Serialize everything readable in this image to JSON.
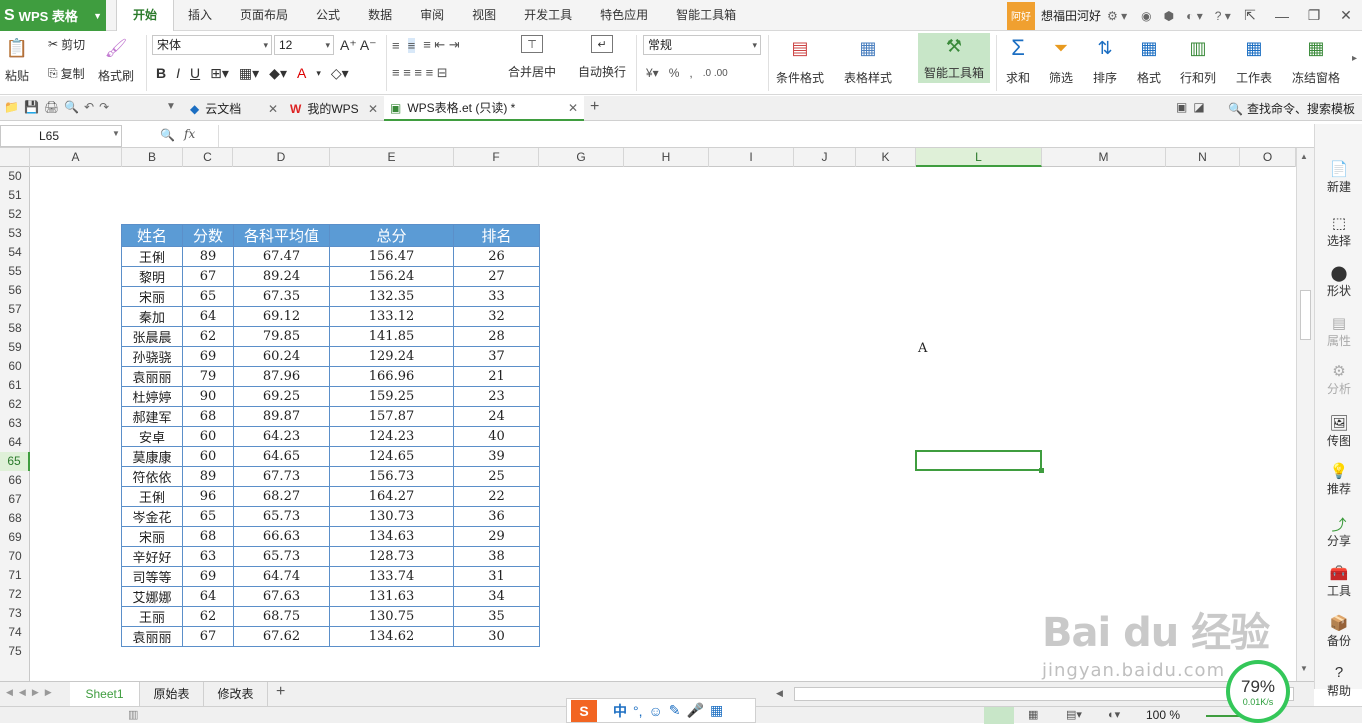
{
  "app": {
    "name": "WPS 表格"
  },
  "ribbon_tabs": [
    "开始",
    "插入",
    "页面布局",
    "公式",
    "数据",
    "审阅",
    "视图",
    "开发工具",
    "特色应用",
    "智能工具箱"
  ],
  "user": {
    "avatar_text": "阿好",
    "name": "想福田河好"
  },
  "toolbar": {
    "paste": "粘贴",
    "cut": "剪切",
    "copy": "复制",
    "format_painter": "格式刷",
    "font_name": "宋体",
    "font_size": "12",
    "number_format": "常规",
    "merge_center": "合并居中",
    "wrap_text": "自动换行",
    "cond_format": "条件格式",
    "table_style": "表格样式",
    "smart_toolbox": "智能工具箱",
    "sum": "求和",
    "filter": "筛选",
    "sort": "排序",
    "format": "格式",
    "row_col": "行和列",
    "worksheet": "工作表",
    "freeze": "冻结窗格"
  },
  "doc_tabs": [
    {
      "label": "云文档"
    },
    {
      "label": "我的WPS"
    },
    {
      "label": "WPS表格.et (只读) *"
    }
  ],
  "search": {
    "label": "查找命令、搜索模板"
  },
  "formula": {
    "namebox": "L65",
    "fx": "fx",
    "value": ""
  },
  "columns": [
    "A",
    "B",
    "C",
    "D",
    "E",
    "F",
    "G",
    "H",
    "I",
    "J",
    "K",
    "L",
    "M",
    "N",
    "O"
  ],
  "rows": [
    "50",
    "51",
    "52",
    "53",
    "54",
    "55",
    "56",
    "57",
    "58",
    "59",
    "60",
    "61",
    "62",
    "63",
    "64",
    "65",
    "66",
    "67",
    "68",
    "69",
    "70",
    "71",
    "72",
    "73",
    "74",
    "75"
  ],
  "table": {
    "headers": [
      "姓名",
      "分数",
      "各科平均值",
      "总分",
      "排名"
    ],
    "rows": [
      [
        "王俐",
        "89",
        "67.47",
        "156.47",
        "26"
      ],
      [
        "黎明",
        "67",
        "89.24",
        "156.24",
        "27"
      ],
      [
        "宋丽",
        "65",
        "67.35",
        "132.35",
        "33"
      ],
      [
        "秦加",
        "64",
        "69.12",
        "133.12",
        "32"
      ],
      [
        "张晨晨",
        "62",
        "79.85",
        "141.85",
        "28"
      ],
      [
        "孙骁骁",
        "69",
        "60.24",
        "129.24",
        "37"
      ],
      [
        "袁丽丽",
        "79",
        "87.96",
        "166.96",
        "21"
      ],
      [
        "杜婷婷",
        "90",
        "69.25",
        "159.25",
        "23"
      ],
      [
        "郝建军",
        "68",
        "89.87",
        "157.87",
        "24"
      ],
      [
        "安卓",
        "60",
        "64.23",
        "124.23",
        "40"
      ],
      [
        "莫康康",
        "60",
        "64.65",
        "124.65",
        "39"
      ],
      [
        "符依依",
        "89",
        "67.73",
        "156.73",
        "25"
      ],
      [
        "王俐",
        "96",
        "68.27",
        "164.27",
        "22"
      ],
      [
        "岑金花",
        "65",
        "65.73",
        "130.73",
        "36"
      ],
      [
        "宋丽",
        "68",
        "66.63",
        "134.63",
        "29"
      ],
      [
        "辛好好",
        "63",
        "65.73",
        "128.73",
        "38"
      ],
      [
        "司等等",
        "69",
        "64.74",
        "133.74",
        "31"
      ],
      [
        "艾娜娜",
        "64",
        "67.63",
        "131.63",
        "34"
      ],
      [
        "王丽",
        "62",
        "68.75",
        "130.75",
        "35"
      ],
      [
        "袁丽丽",
        "67",
        "67.62",
        "134.62",
        "30"
      ]
    ]
  },
  "cell_text": "A",
  "side_panel": [
    "新建",
    "选择",
    "形状",
    "属性",
    "分析",
    "传图",
    "推荐",
    "分享",
    "工具",
    "备份",
    "帮助"
  ],
  "sheets": [
    "Sheet1",
    "原始表",
    "修改表"
  ],
  "status": {
    "zoom": "100 %",
    "speed_percent": "79%",
    "speed_rate": "0.01K/s"
  },
  "ime": {
    "lang": "中"
  },
  "watermark": {
    "brand": "Bai du 经验",
    "url": "jingyan.baidu.com"
  }
}
